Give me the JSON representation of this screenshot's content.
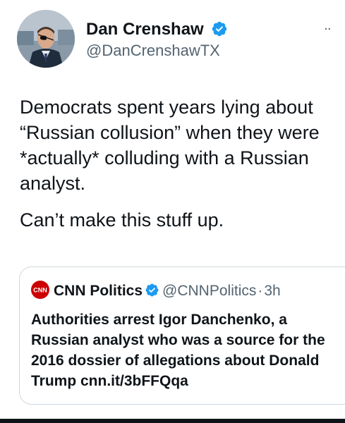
{
  "tweet": {
    "author": {
      "display_name": "Dan Crenshaw",
      "handle": "@DanCrenshawTX",
      "verified": true,
      "avatar_icon": "profile-photo"
    },
    "more_label": "..",
    "text_lines": [
      "Democrats spent years lying about “Russian collusion” when they were *actually* colluding with a Russian analyst.",
      "Can’t make this stuff up."
    ]
  },
  "quoted_tweet": {
    "logo_label": "CNN",
    "display_name": "CNN Politics",
    "verified": true,
    "handle": "@CNNPolitics",
    "separator": "·",
    "time": "3h",
    "text": "Authorities arrest Igor Danchenko, a Russian analyst who was a source for the 2016 dossier of allegations about Donald Trump cnn.it/3bFFQqa"
  },
  "colors": {
    "verified_blue": "#1d9bf0",
    "cnn_red": "#cc0000",
    "secondary_text": "#536471",
    "border": "#cfd9de"
  }
}
